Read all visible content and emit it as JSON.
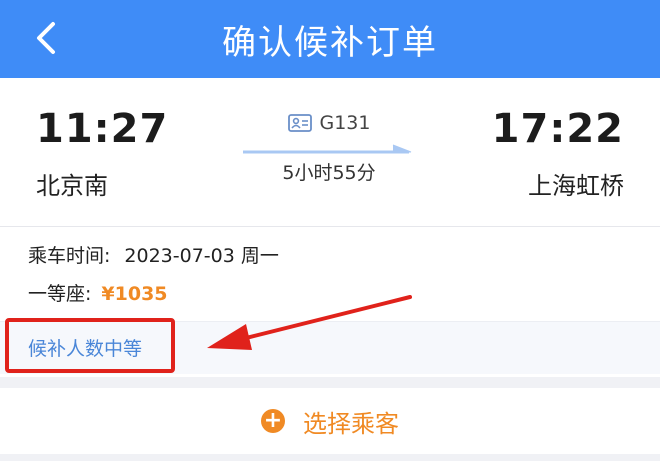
{
  "header": {
    "title": "确认候补订单",
    "back_icon": "chevron-left-icon"
  },
  "trip": {
    "departure_time": "11:27",
    "departure_station": "北京南",
    "arrival_time": "17:22",
    "arrival_station": "上海虹桥",
    "train_number": "G131",
    "train_icon": "id-card-icon",
    "duration": "5小时55分"
  },
  "details": {
    "ride_time_label": "乘车时间:",
    "ride_time_value": "2023-07-03 周一",
    "seat_label": "一等座:",
    "price": "¥1035",
    "waitlist_status": "候补人数中等"
  },
  "select_passenger": {
    "label": "选择乘客",
    "icon": "plus-circle-icon"
  },
  "colors": {
    "header_bg": "#3f8cf7",
    "accent_orange": "#f08a24",
    "link_blue": "#4a86d8",
    "annotation_red": "#e0221b"
  }
}
